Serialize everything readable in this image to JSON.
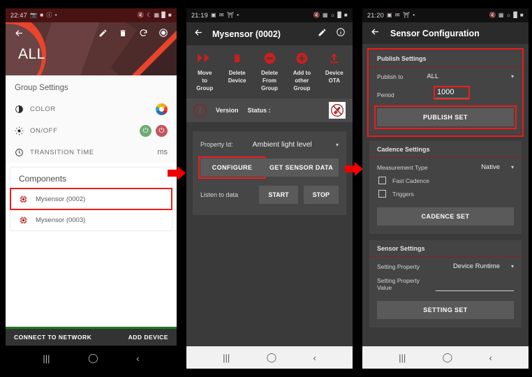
{
  "panel1": {
    "statusbar": {
      "time": "22:47",
      "left_icons": [
        "photo-icon",
        "folder-icon",
        "do-not-disturb-icon",
        "dot-icon"
      ],
      "right_icons": [
        "mute-icon",
        "wifi-icon",
        "sim-icon",
        "signal-icon",
        "battery-icon"
      ]
    },
    "appbar": {
      "back": "←",
      "edit_icon": "pencil-icon",
      "delete_icon": "trash-icon",
      "refresh_icon": "refresh-icon",
      "record_icon": "record-icon"
    },
    "hero_title": "ALL",
    "group_settings_title": "Group Settings",
    "rows": [
      {
        "icon": "contrast-icon",
        "label": "COLOR",
        "control": "color-wheel"
      },
      {
        "icon": "brightness-icon",
        "label": "ON/OFF",
        "control": "power-toggle"
      },
      {
        "icon": "clock-icon",
        "label": "TRANSITION TIME",
        "control": "ms",
        "value": "ms"
      }
    ],
    "components_title": "Components",
    "components": [
      {
        "label": "Mysensor (0002)",
        "highlighted": true
      },
      {
        "label": "Mysensor (0003)",
        "highlighted": false
      }
    ],
    "bottom_bar": {
      "connect": "CONNECT TO NETWORK",
      "add": "ADD DEVICE"
    },
    "navbar": {
      "recents": "|||",
      "home": "◯",
      "back": "‹"
    }
  },
  "panel2": {
    "statusbar": {
      "time": "21:19",
      "left_icons": [
        "photo-icon",
        "mail-icon",
        "bluetooth-icon",
        "dot-icon"
      ],
      "right_icons": [
        "mute-icon",
        "sim-icon",
        "wifi-icon",
        "signal-icon",
        "battery-icon"
      ]
    },
    "appbar": {
      "back": "←",
      "title": "Mysensor (0002)",
      "edit_icon": "pencil-icon",
      "info_icon": "info-icon"
    },
    "actions": [
      {
        "icon": "fast-forward-icon",
        "label": "Move\nto\nGroup"
      },
      {
        "icon": "trash-icon",
        "label": "Delete\nDevice"
      },
      {
        "icon": "minus-circle-icon",
        "label": "Delete\nFrom\nGroup"
      },
      {
        "icon": "plus-circle-icon",
        "label": "Add to\nother\nGroup"
      },
      {
        "icon": "upload-icon",
        "label": "Device\nOTA"
      }
    ],
    "info_row": {
      "badge": "i",
      "version": "Version",
      "status": "Status :",
      "broom_icon": "broom-icon"
    },
    "property": {
      "label": "Property Id:",
      "value": "Ambient light level",
      "caret": "▾"
    },
    "buttons": {
      "configure": "CONFIGURE",
      "get_sensor_data": "GET SENSOR DATA"
    },
    "listen": {
      "label": "Listen to data",
      "start": "START",
      "stop": "STOP"
    },
    "navbar": {
      "recents": "|||",
      "home": "◯",
      "back": "‹"
    }
  },
  "panel3": {
    "statusbar": {
      "time": "21:20",
      "left_icons": [
        "photo-icon",
        "mail-icon",
        "bluetooth-icon",
        "dot-icon"
      ],
      "right_icons": [
        "mute-icon",
        "sim-icon",
        "wifi-icon",
        "signal-icon",
        "battery-icon"
      ]
    },
    "appbar": {
      "back": "←",
      "title": "Sensor Configuration"
    },
    "publish": {
      "header": "Publish Settings",
      "publish_to_label": "Publish to",
      "publish_to_value": "ALL",
      "period_label": "Period",
      "period_value": "1000",
      "button": "PUBLISH SET"
    },
    "cadence": {
      "header": "Cadence Settings",
      "measurement_label": "Measurement Type",
      "measurement_value": "Native",
      "fast_cadence": "Fast Cadence",
      "triggers": "Triggers",
      "button": "CADENCE SET"
    },
    "sensor": {
      "header": "Sensor Settings",
      "setting_property_label": "Setting Property",
      "setting_property_value": "Device Runtime",
      "setting_value_label": "Setting Property Value",
      "setting_value": "",
      "button": "SETTING SET"
    },
    "navbar": {
      "recents": "|||",
      "home": "◯",
      "back": "‹"
    }
  },
  "colors": {
    "accent_red": "#f21b1b",
    "brand_red": "#cc1f1f",
    "maroon": "#4a1313",
    "panel_dark": "#3a3a3a",
    "green": "#1f7a1f"
  }
}
